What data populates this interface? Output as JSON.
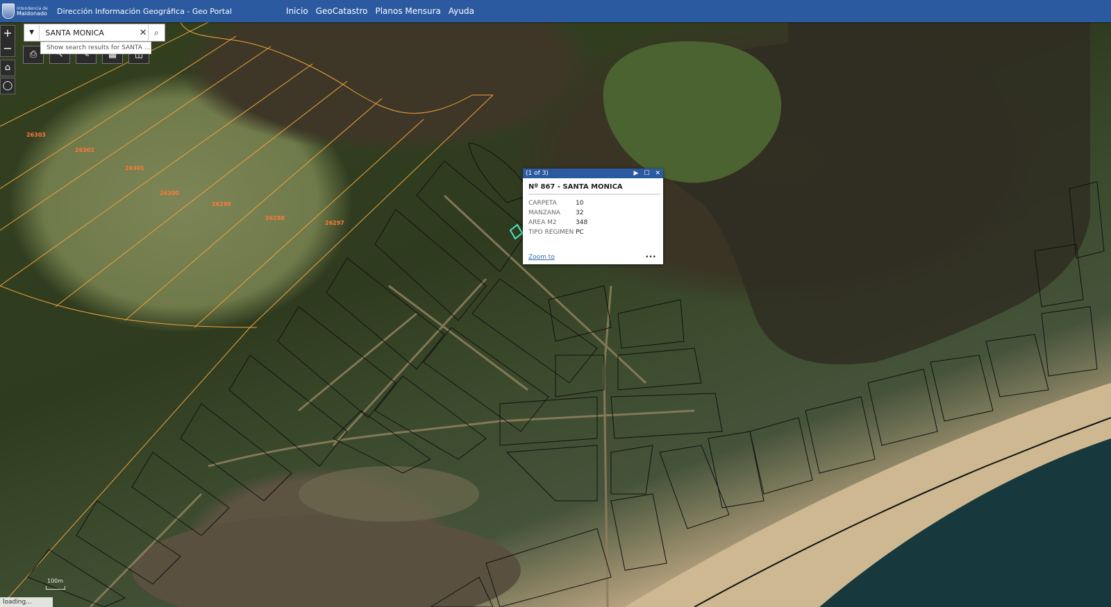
{
  "header": {
    "org_small": "Intendencia de",
    "org_big": "Maldonado",
    "title": "Dirección Información Geográfica -  Geo Portal",
    "nav": [
      "Inicio",
      "GeoCatastro",
      "Planos Mensura",
      "Ayuda"
    ]
  },
  "search": {
    "value": "SANTA MONICA",
    "suggestion": "Show search results for SANTA ..."
  },
  "controls": {
    "zoom_in": "+",
    "zoom_out": "−"
  },
  "lot_labels": [
    "26303",
    "26302",
    "26301",
    "26300",
    "26299",
    "26298",
    "26297"
  ],
  "popup": {
    "count": "(1 of 3)",
    "title": "Nº 867 - SANTA MONICA",
    "fields": [
      {
        "key": "CARPETA",
        "value": "10"
      },
      {
        "key": "MANZANA",
        "value": "32"
      },
      {
        "key": "AREA M2",
        "value": "348"
      },
      {
        "key": "TIPO REGIMEN",
        "value": "PC"
      }
    ],
    "zoom_link": "Zoom to",
    "more": "•••"
  },
  "scale": "100m",
  "status": "loading..."
}
